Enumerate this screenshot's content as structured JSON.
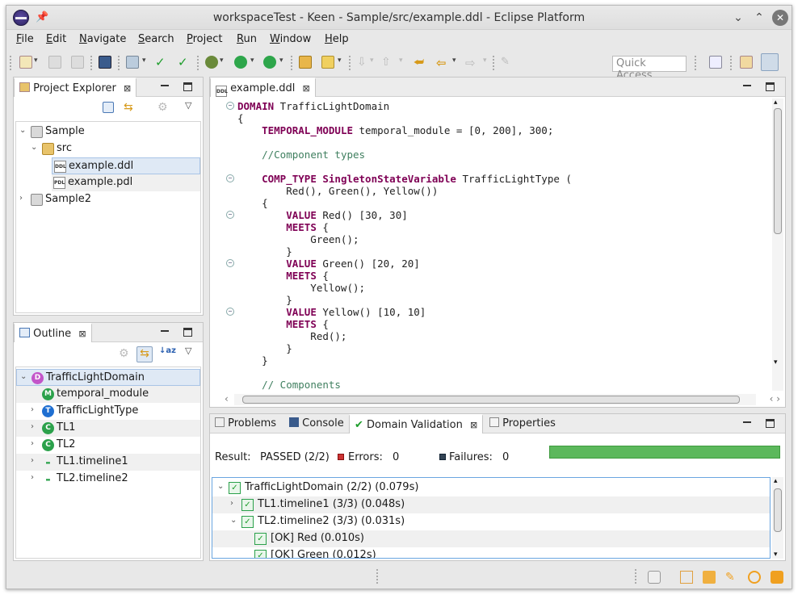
{
  "window": {
    "title": "workspaceTest - Keen - Sample/src/example.ddl - Eclipse Platform"
  },
  "menu": [
    "File",
    "Edit",
    "Navigate",
    "Search",
    "Project",
    "Run",
    "Window",
    "Help"
  ],
  "toolbar": {
    "quick_access_placeholder": "Quick Access"
  },
  "project_explorer": {
    "tab_label": "Project Explorer",
    "items": [
      {
        "label": "Sample",
        "type": "project",
        "expanded": true
      },
      {
        "label": "src",
        "type": "folder",
        "expanded": true
      },
      {
        "label": "example.ddl",
        "type": "file",
        "icon_text": "DDL",
        "selected": true
      },
      {
        "label": "example.pdl",
        "type": "file",
        "icon_text": "PDL"
      },
      {
        "label": "Sample2",
        "type": "project",
        "expanded": false
      }
    ]
  },
  "outline": {
    "tab_label": "Outline",
    "items": [
      {
        "label": "TrafficLightDomain",
        "icon_letter": "D",
        "icon_color": "#c355c9",
        "selected": true
      },
      {
        "label": "temporal_module",
        "icon_letter": "M",
        "icon_color": "#2ba14b"
      },
      {
        "label": "TrafficLightType",
        "icon_letter": "T",
        "icon_color": "#1f6fd1"
      },
      {
        "label": "TL1",
        "icon_letter": "C",
        "icon_color": "#2ba14b"
      },
      {
        "label": "TL2",
        "icon_letter": "C",
        "icon_color": "#2ba14b"
      },
      {
        "label": "TL1.timeline1",
        "icon_letter": "-",
        "icon_color": "#2ba14b"
      },
      {
        "label": "TL2.timeline2",
        "icon_letter": "-",
        "icon_color": "#2ba14b"
      }
    ]
  },
  "editor": {
    "tab_label": "example.ddl",
    "lines": [
      [
        [
          "kw",
          "DOMAIN"
        ],
        [
          "t",
          " TrafficLightDomain"
        ]
      ],
      [
        [
          "t",
          "{"
        ]
      ],
      [
        [
          "t",
          "    "
        ],
        [
          "kw",
          "TEMPORAL_MODULE"
        ],
        [
          "t",
          " temporal_module = [0, 200], 300;"
        ]
      ],
      [
        [
          "t",
          ""
        ]
      ],
      [
        [
          "t",
          "    "
        ],
        [
          "cm",
          "//Component types"
        ]
      ],
      [
        [
          "t",
          ""
        ]
      ],
      [
        [
          "t",
          "    "
        ],
        [
          "kw",
          "COMP_TYPE SingletonStateVariable"
        ],
        [
          "t",
          " TrafficLightType ("
        ]
      ],
      [
        [
          "t",
          "        Red(), Green(), Yellow())"
        ]
      ],
      [
        [
          "t",
          "    {"
        ]
      ],
      [
        [
          "t",
          "        "
        ],
        [
          "kw",
          "VALUE"
        ],
        [
          "t",
          " Red() [30, 30]"
        ]
      ],
      [
        [
          "t",
          "        "
        ],
        [
          "kw",
          "MEETS"
        ],
        [
          "t",
          " {"
        ]
      ],
      [
        [
          "t",
          "            Green();"
        ]
      ],
      [
        [
          "t",
          "        }"
        ]
      ],
      [
        [
          "t",
          "        "
        ],
        [
          "kw",
          "VALUE"
        ],
        [
          "t",
          " Green() [20, 20]"
        ]
      ],
      [
        [
          "t",
          "        "
        ],
        [
          "kw",
          "MEETS"
        ],
        [
          "t",
          " {"
        ]
      ],
      [
        [
          "t",
          "            Yellow();"
        ]
      ],
      [
        [
          "t",
          "        }"
        ]
      ],
      [
        [
          "t",
          "        "
        ],
        [
          "kw",
          "VALUE"
        ],
        [
          "t",
          " Yellow() [10, 10]"
        ]
      ],
      [
        [
          "t",
          "        "
        ],
        [
          "kw",
          "MEETS"
        ],
        [
          "t",
          " {"
        ]
      ],
      [
        [
          "t",
          "            Red();"
        ]
      ],
      [
        [
          "t",
          "        }"
        ]
      ],
      [
        [
          "t",
          "    }"
        ]
      ],
      [
        [
          "t",
          ""
        ]
      ],
      [
        [
          "t",
          "    "
        ],
        [
          "cm",
          "// Components"
        ]
      ]
    ]
  },
  "bottom_panel": {
    "tabs": [
      "Problems",
      "Console",
      "Domain Validation",
      "Properties"
    ],
    "active_tab": "Domain Validation",
    "result_label": "Result:",
    "result_value": "PASSED (2/2)",
    "errors_label": "Errors:",
    "errors_value": "0",
    "failures_label": "Failures:",
    "failures_value": "0",
    "progress_fraction": 1.0,
    "results": [
      {
        "label": "TrafficLightDomain (2/2) (0.079s)",
        "level": 0
      },
      {
        "label": "TL1.timeline1 (3/3) (0.048s)",
        "level": 1
      },
      {
        "label": "TL2.timeline2 (3/3) (0.031s)",
        "level": 1
      },
      {
        "label": "[OK] Red (0.010s)",
        "level": 2
      },
      {
        "label": "[OK] Green (0.012s)",
        "level": 2
      }
    ]
  }
}
